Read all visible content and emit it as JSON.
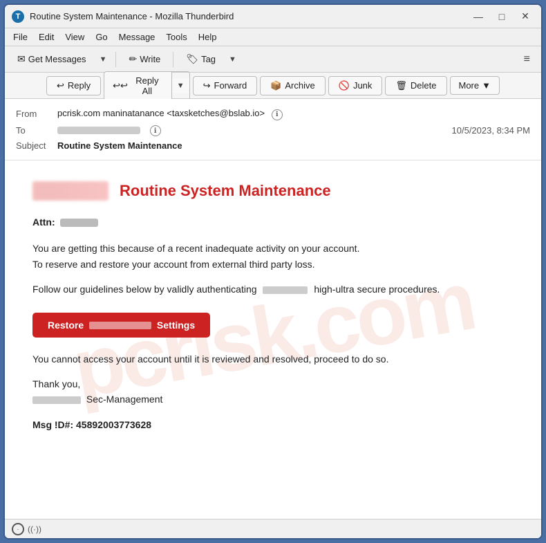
{
  "window": {
    "title": "Routine System Maintenance - Mozilla Thunderbird",
    "controls": {
      "minimize": "—",
      "maximize": "□",
      "close": "✕"
    }
  },
  "menu": {
    "items": [
      "File",
      "Edit",
      "View",
      "Go",
      "Message",
      "Tools",
      "Help"
    ]
  },
  "toolbar": {
    "get_messages": "Get Messages",
    "write": "Write",
    "tag": "Tag",
    "hamburger": "≡"
  },
  "reply_toolbar": {
    "reply": "Reply",
    "reply_all": "Reply All",
    "forward": "Forward",
    "archive": "Archive",
    "junk": "Junk",
    "delete": "Delete",
    "more": "More"
  },
  "email": {
    "from_label": "From",
    "from_name": "pcrisk.com maninatanance",
    "from_email": "<taxsketches@bslab.io>",
    "to_label": "To",
    "date": "10/5/2023, 8:34 PM",
    "subject_label": "Subject",
    "subject": "Routine System Maintenance"
  },
  "email_body": {
    "title": "Routine System Maintenance",
    "attn_label": "Attn:",
    "para1_line1": "You are getting this because of a recent inadequate activity on your account.",
    "para1_line2": "To reserve and restore your account from external third party loss.",
    "para2_prefix": "Follow our guidelines below by validly authenticating",
    "para2_suffix": "high-ultra secure procedures.",
    "restore_prefix": "Restore",
    "restore_suffix": "Settings",
    "para3": "You cannot access your account until it is reviewed and resolved, proceed to do so.",
    "thanks": "Thank you,",
    "sec_mgmt": "Sec-Management",
    "msg_id_label": "Msg !D#:",
    "msg_id": "45892003773628"
  },
  "status_bar": {
    "icon": "((·))"
  }
}
